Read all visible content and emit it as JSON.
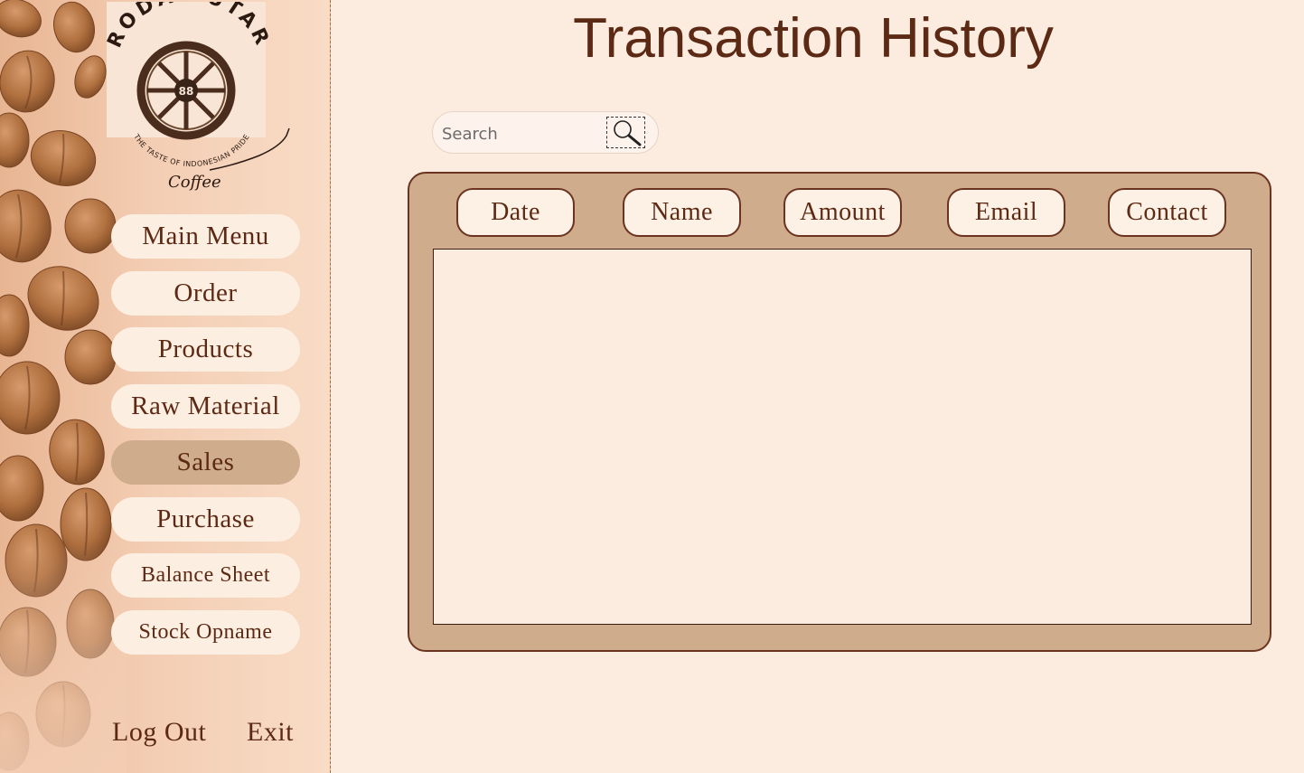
{
  "app": {
    "brand": "RODA PUTAR",
    "brand_number": "88",
    "brand_tagline": "THE TASTE OF INDONESIAN PRIDE",
    "brand_sub": "Coffee"
  },
  "sidebar": {
    "items": [
      {
        "label": "Main Menu",
        "active": false
      },
      {
        "label": "Order",
        "active": false
      },
      {
        "label": "Products",
        "active": false
      },
      {
        "label": "Raw Material",
        "active": false
      },
      {
        "label": "Sales",
        "active": true
      },
      {
        "label": "Purchase",
        "active": false
      },
      {
        "label": "Balance Sheet",
        "active": false
      },
      {
        "label": "Stock Opname",
        "active": false
      }
    ],
    "logout_label": "Log Out",
    "exit_label": "Exit"
  },
  "main": {
    "title": "Transaction History",
    "search": {
      "placeholder": "Search",
      "value": "",
      "icon": "magnifier-icon"
    },
    "table": {
      "columns": [
        "Date",
        "Name",
        "Amount",
        "Email",
        "Contact"
      ],
      "rows": []
    }
  },
  "colors": {
    "background": "#fcece0",
    "text": "#5c2a14",
    "panel": "#cfac8b",
    "active_nav": "#cfac8b",
    "border": "#6b3320"
  }
}
